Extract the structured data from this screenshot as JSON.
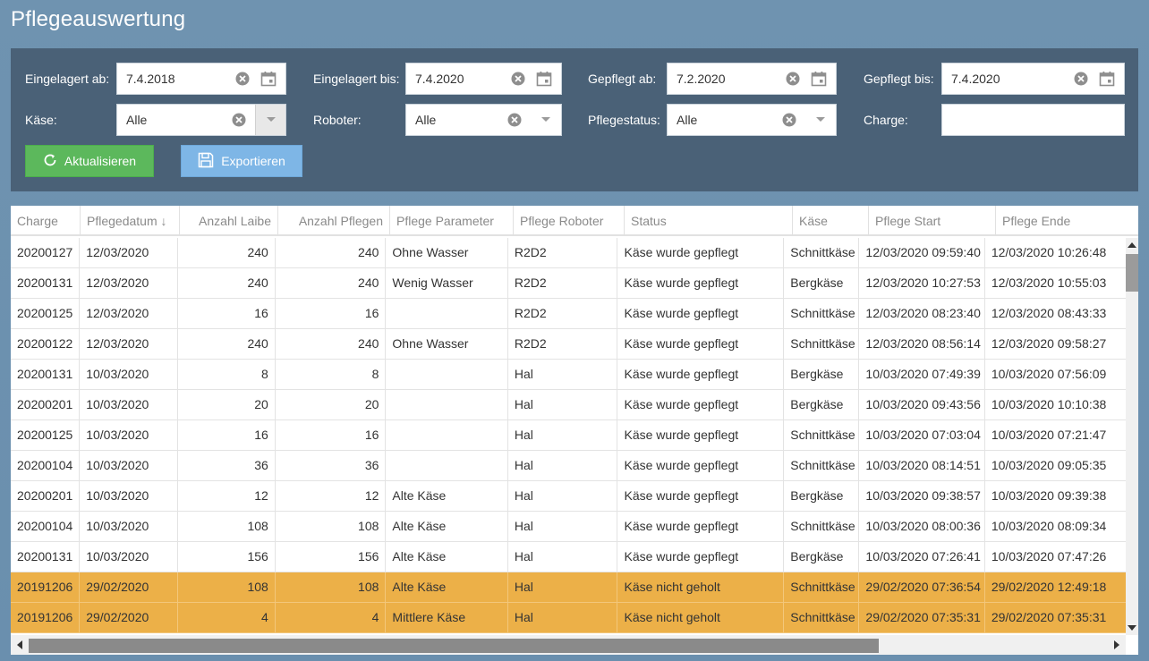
{
  "title": "Pflegeauswertung",
  "filters": {
    "eingelagert_ab": {
      "label": "Eingelagert ab:",
      "value": "7.4.2018"
    },
    "eingelagert_bis": {
      "label": "Eingelagert bis:",
      "value": "7.4.2020"
    },
    "gepflegt_ab": {
      "label": "Gepflegt ab:",
      "value": "7.2.2020"
    },
    "gepflegt_bis": {
      "label": "Gepflegt bis:",
      "value": "7.4.2020"
    },
    "kaese": {
      "label": "Käse:",
      "value": "Alle"
    },
    "roboter": {
      "label": "Roboter:",
      "value": "Alle"
    },
    "pflegestatus": {
      "label": "Pflegestatus:",
      "value": "Alle"
    },
    "charge": {
      "label": "Charge:",
      "value": ""
    }
  },
  "buttons": {
    "refresh": "Aktualisieren",
    "export": "Exportieren"
  },
  "columns": [
    "Charge",
    "Pflegedatum ↓",
    "Anzahl Laibe",
    "Anzahl Pflegen",
    "Pflege Parameter",
    "Pflege Roboter",
    "Status",
    "Käse",
    "Pflege Start",
    "Pflege Ende"
  ],
  "rows": [
    [
      "20200127",
      "12/03/2020",
      "240",
      "240",
      "Ohne Wasser",
      "R2D2",
      "Käse wurde gepflegt",
      "Schnittkäse",
      "12/03/2020 09:59:40",
      "12/03/2020 10:26:48"
    ],
    [
      "20200131",
      "12/03/2020",
      "240",
      "240",
      "Wenig Wasser",
      "R2D2",
      "Käse wurde gepflegt",
      "Bergkäse",
      "12/03/2020 10:27:53",
      "12/03/2020 10:55:03"
    ],
    [
      "20200125",
      "12/03/2020",
      "16",
      "16",
      "",
      "R2D2",
      "Käse wurde gepflegt",
      "Schnittkäse",
      "12/03/2020 08:23:40",
      "12/03/2020 08:43:33"
    ],
    [
      "20200122",
      "12/03/2020",
      "240",
      "240",
      "Ohne Wasser",
      "R2D2",
      "Käse wurde gepflegt",
      "Schnittkäse",
      "12/03/2020 08:56:14",
      "12/03/2020 09:58:27"
    ],
    [
      "20200131",
      "10/03/2020",
      "8",
      "8",
      "",
      "Hal",
      "Käse wurde gepflegt",
      "Bergkäse",
      "10/03/2020 07:49:39",
      "10/03/2020 07:56:09"
    ],
    [
      "20200201",
      "10/03/2020",
      "20",
      "20",
      "",
      "Hal",
      "Käse wurde gepflegt",
      "Bergkäse",
      "10/03/2020 09:43:56",
      "10/03/2020 10:10:38"
    ],
    [
      "20200125",
      "10/03/2020",
      "16",
      "16",
      "",
      "Hal",
      "Käse wurde gepflegt",
      "Schnittkäse",
      "10/03/2020 07:03:04",
      "10/03/2020 07:21:47"
    ],
    [
      "20200104",
      "10/03/2020",
      "36",
      "36",
      "",
      "Hal",
      "Käse wurde gepflegt",
      "Schnittkäse",
      "10/03/2020 08:14:51",
      "10/03/2020 09:05:35"
    ],
    [
      "20200201",
      "10/03/2020",
      "12",
      "12",
      "Alte Käse",
      "Hal",
      "Käse wurde gepflegt",
      "Bergkäse",
      "10/03/2020 09:38:57",
      "10/03/2020 09:39:38"
    ],
    [
      "20200104",
      "10/03/2020",
      "108",
      "108",
      "Alte Käse",
      "Hal",
      "Käse wurde gepflegt",
      "Schnittkäse",
      "10/03/2020 08:00:36",
      "10/03/2020 08:09:34"
    ],
    [
      "20200131",
      "10/03/2020",
      "156",
      "156",
      "Alte Käse",
      "Hal",
      "Käse wurde gepflegt",
      "Bergkäse",
      "10/03/2020 07:26:41",
      "10/03/2020 07:47:26"
    ],
    [
      "20191206",
      "29/02/2020",
      "108",
      "108",
      "Alte Käse",
      "Hal",
      "Käse nicht geholt",
      "Schnittkäse",
      "29/02/2020 07:36:54",
      "29/02/2020 12:49:18"
    ],
    [
      "20191206",
      "29/02/2020",
      "4",
      "4",
      "Mittlere Käse",
      "Hal",
      "Käse nicht geholt",
      "Schnittkäse",
      "29/02/2020 07:35:31",
      "29/02/2020 07:35:31"
    ]
  ],
  "colors": {
    "warning_row": "#ecb048",
    "panel": "#4a6177",
    "refresh_button": "#5cb85c",
    "export_button": "#7eb6e6"
  }
}
